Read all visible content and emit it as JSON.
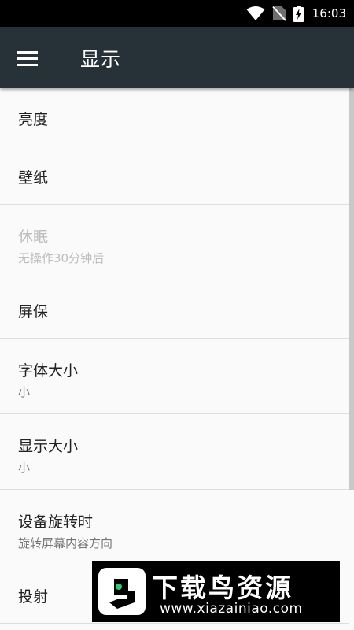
{
  "status_bar": {
    "time": "16:03",
    "icons": [
      "wifi-icon",
      "no-sim-icon",
      "battery-charging-icon"
    ]
  },
  "toolbar": {
    "menu_icon": "menu-icon",
    "title": "显示"
  },
  "settings": {
    "items": [
      {
        "title": "亮度",
        "summary": ""
      },
      {
        "title": "壁纸",
        "summary": ""
      },
      {
        "title": "休眠",
        "summary": "无操作30分钟后",
        "enabled": false
      },
      {
        "title": "屏保",
        "summary": ""
      },
      {
        "title": "字体大小",
        "summary": "小"
      },
      {
        "title": "显示大小",
        "summary": "小"
      },
      {
        "title": "设备旋转时",
        "summary": "旋转屏幕内容方向"
      },
      {
        "title": "投射",
        "summary": ""
      }
    ]
  },
  "watermark": {
    "title": "下载鸟资源",
    "url": "www.xiazainiao.com"
  },
  "colors": {
    "toolbar_bg": "#263238",
    "list_bg": "#fafafa",
    "disabled_text": "#bdbdbd"
  }
}
